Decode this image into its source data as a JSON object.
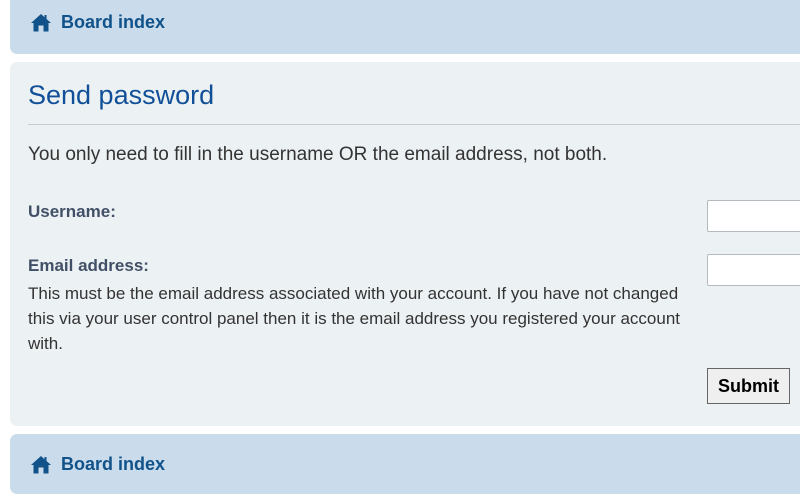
{
  "nav_top": {
    "icon": "home-icon",
    "label": "Board index"
  },
  "panel": {
    "title": "Send password",
    "intro": "You only need to fill in the username OR the email address, not both.",
    "username_label": "Username:",
    "username_value": "",
    "email_label": "Email address:",
    "email_explain": "This must be the email address associated with your account. If you have not changed this via your user control panel then it is the email address you registered your account with.",
    "email_value": "",
    "submit_label": "Submit"
  },
  "nav_bottom": {
    "icon": "home-icon",
    "label": "Board index"
  },
  "colors": {
    "nav_bg": "#cadceb",
    "panel_bg": "#ecf1f3",
    "link": "#105289",
    "title": "#115098",
    "label": "#425067"
  }
}
